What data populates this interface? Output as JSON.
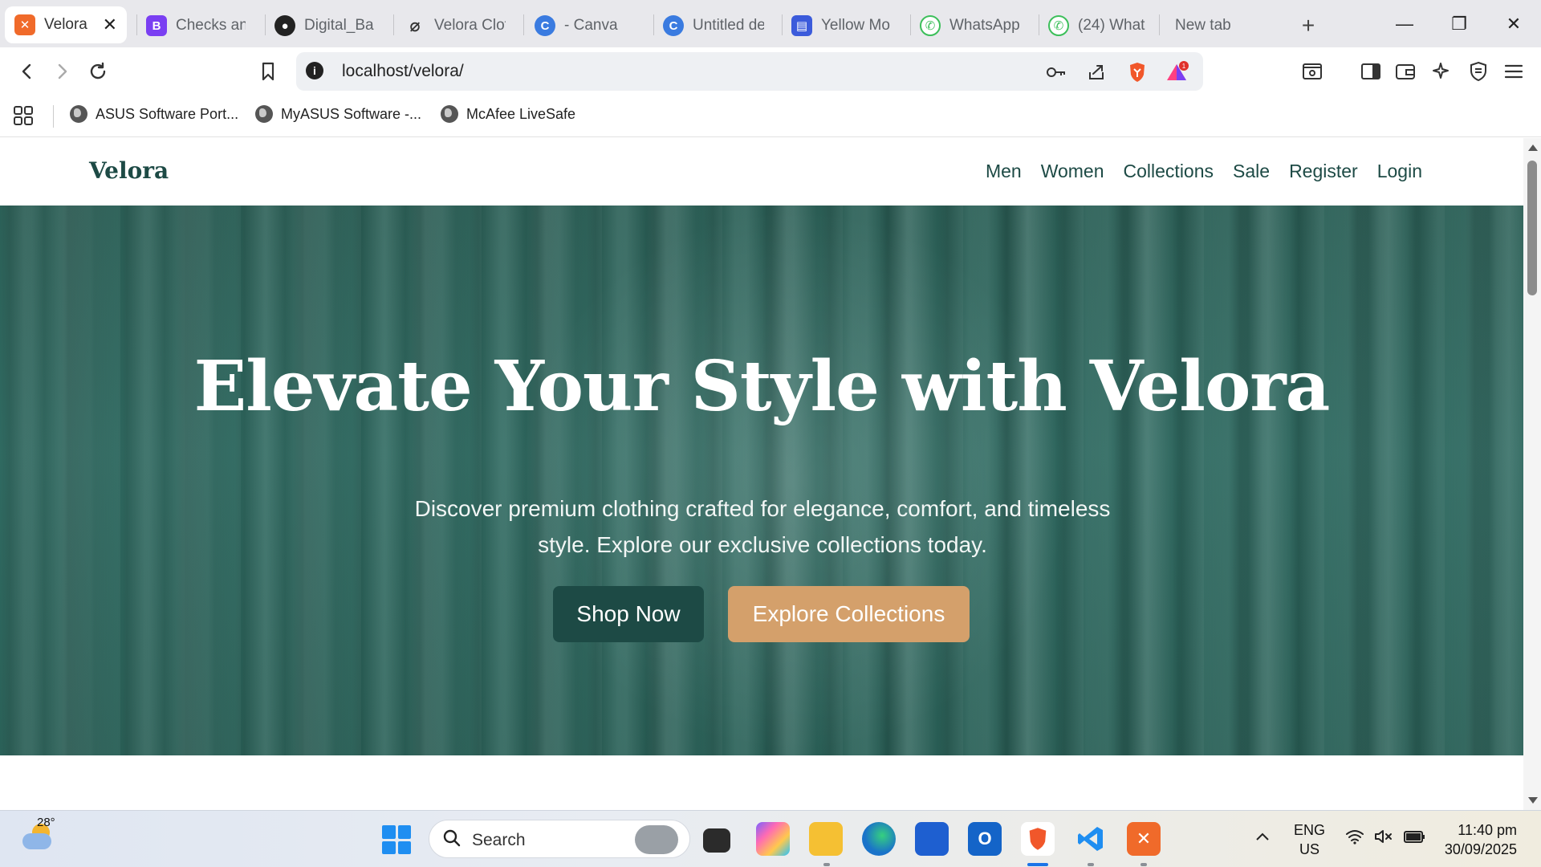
{
  "browser": {
    "tabs": [
      {
        "title": "Velora",
        "favicon": "xampp-icon",
        "active": true
      },
      {
        "title": "Checks an",
        "favicon": "bootstrap-icon"
      },
      {
        "title": "Digital_Ba",
        "favicon": "github-icon"
      },
      {
        "title": "Velora Clot",
        "favicon": "leaf-icon"
      },
      {
        "title": "- Canva",
        "favicon": "canva-icon"
      },
      {
        "title": "Untitled de",
        "favicon": "canva-icon"
      },
      {
        "title": "Yellow Mo",
        "favicon": "printer-icon"
      },
      {
        "title": "WhatsApp",
        "favicon": "whatsapp-icon"
      },
      {
        "title": "(24) What",
        "favicon": "whatsapp-icon"
      },
      {
        "title": "New tab",
        "favicon": ""
      }
    ],
    "url": "localhost/velora/",
    "notification_badge": "1",
    "bookmarks": [
      {
        "label": "ASUS Software Port..."
      },
      {
        "label": "MyASUS Software -..."
      },
      {
        "label": "McAfee LiveSafe"
      }
    ]
  },
  "site": {
    "brand": "Velora",
    "nav": [
      "Men",
      "Women",
      "Collections",
      "Sale",
      "Register",
      "Login"
    ],
    "hero": {
      "title": "Elevate Your Style with Velora",
      "subtitle": "Discover premium clothing crafted for elegance, comfort, and timeless style. Explore our exclusive collections today.",
      "primary_cta": "Shop Now",
      "secondary_cta": "Explore Collections"
    },
    "colors": {
      "brand_green": "#1d4a45",
      "accent_tan": "#d4a06b",
      "hero_overlay": "#2b6057"
    }
  },
  "taskbar": {
    "temperature": "28°",
    "search_label": "Search",
    "lang_line1": "ENG",
    "lang_line2": "US",
    "time": "11:40 pm",
    "date": "30/09/2025"
  }
}
